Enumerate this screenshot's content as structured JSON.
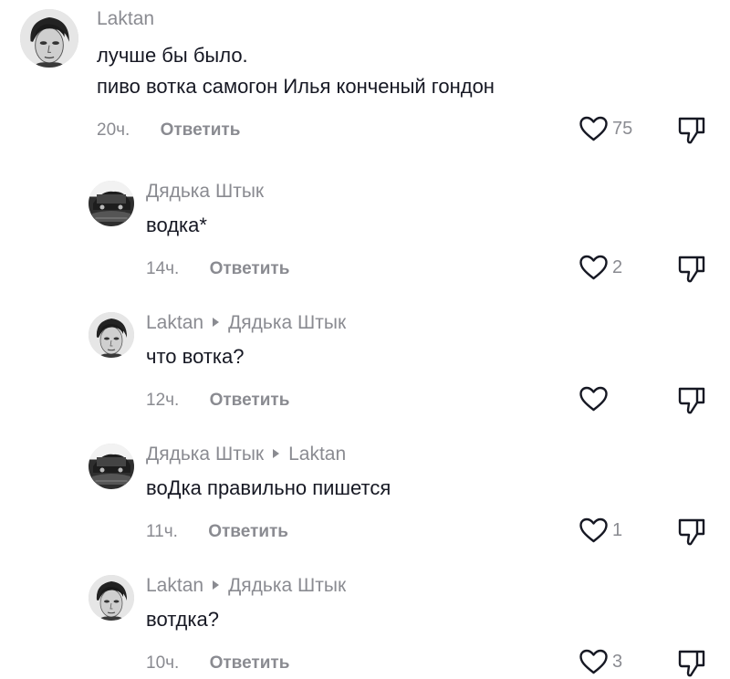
{
  "comments": [
    {
      "author": "Laktan",
      "reply_to": "",
      "lines": [
        "лучше бы было.",
        "пиво вотка самогон Илья конченый гондон"
      ],
      "time": "20ч.",
      "reply_label": "Ответить",
      "likes": "75"
    },
    {
      "author": "Дядька Штык",
      "reply_to": "",
      "lines": [
        "водка*"
      ],
      "time": "14ч.",
      "reply_label": "Ответить",
      "likes": "2"
    },
    {
      "author": "Laktan",
      "reply_to": "Дядька Штык",
      "lines": [
        "что вотка?"
      ],
      "time": "12ч.",
      "reply_label": "Ответить",
      "likes": ""
    },
    {
      "author": "Дядька Штык",
      "reply_to": "Laktan",
      "lines": [
        "воДка правильно пишется"
      ],
      "time": "11ч.",
      "reply_label": "Ответить",
      "likes": "1"
    },
    {
      "author": "Laktan",
      "reply_to": "Дядька Штык",
      "lines": [
        "вотдка?"
      ],
      "time": "10ч.",
      "reply_label": "Ответить",
      "likes": "3"
    }
  ],
  "icons": {
    "like": "heart-outline-icon",
    "dislike": "thumbs-down-outline-icon",
    "reply_arrow": "triangle-right-icon"
  },
  "colors": {
    "primary_text": "#161823",
    "secondary_text": "#8a8b91",
    "icon_stroke": "#161823"
  }
}
